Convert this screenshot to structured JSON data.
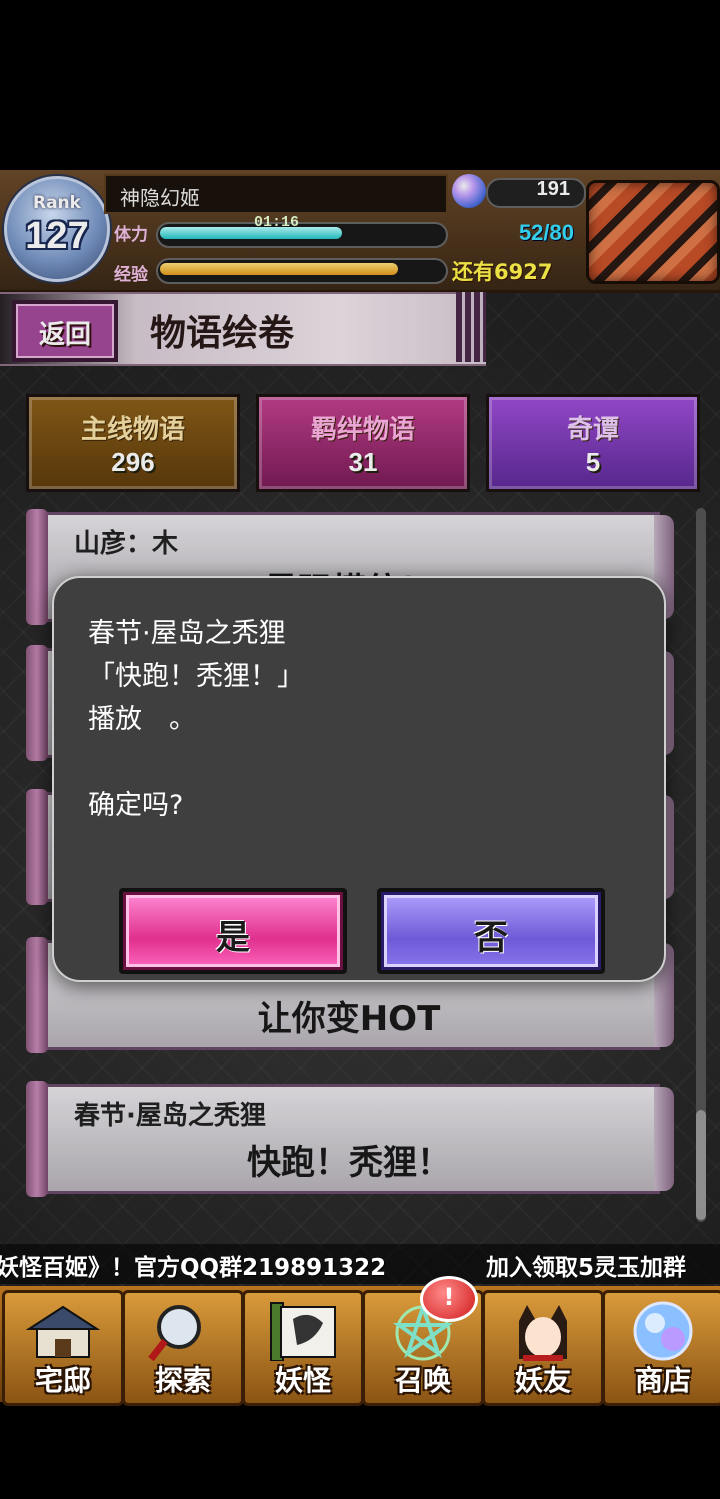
{
  "status": {
    "rank_label": "Rank",
    "rank_value": "127",
    "player_name": "神隐幻姬",
    "gems": "191",
    "stamina_label": "体力",
    "stamina_timer": "01:16",
    "stamina_value": "52/80",
    "stamina_fraction": 0.65,
    "exp_label": "经验",
    "exp_remaining": "还有6927",
    "exp_fraction": 0.85
  },
  "header": {
    "back_label": "返回",
    "title": "物语绘卷"
  },
  "tabs": [
    {
      "label": "主线物语",
      "count": "296",
      "color": "#8a5e18"
    },
    {
      "label": "羁绊物语",
      "count": "31",
      "color": "#c2408e"
    },
    {
      "label": "奇谭",
      "count": "5",
      "color": "#9e4ed8"
    }
  ],
  "stories": [
    {
      "subtitle": "山彦：木",
      "title": "最强模仿！"
    },
    {
      "subtitle": "",
      "title": "让你变HOT"
    },
    {
      "subtitle": "春节·屋岛之秃狸",
      "title": "快跑！秃狸！"
    }
  ],
  "dialog": {
    "message": "春节·屋岛之秃狸\n「快跑！秃狸！」\n播放　。\n\n确定吗?",
    "yes_label": "是",
    "no_label": "否"
  },
  "ticker": {
    "text_1": "妖怪百姬》！官方QQ群219891322",
    "text_2": "加入领取5灵玉加群"
  },
  "nav": {
    "items": [
      {
        "label": "宅邸",
        "icon": "mansion-icon"
      },
      {
        "label": "探索",
        "icon": "magnifier-icon"
      },
      {
        "label": "妖怪",
        "icon": "scroll-icon"
      },
      {
        "label": "召唤",
        "icon": "pentagram-icon"
      },
      {
        "label": "妖友",
        "icon": "fox-girl-icon"
      },
      {
        "label": "商店",
        "icon": "orb-icon"
      }
    ],
    "summon_badge": "!"
  }
}
